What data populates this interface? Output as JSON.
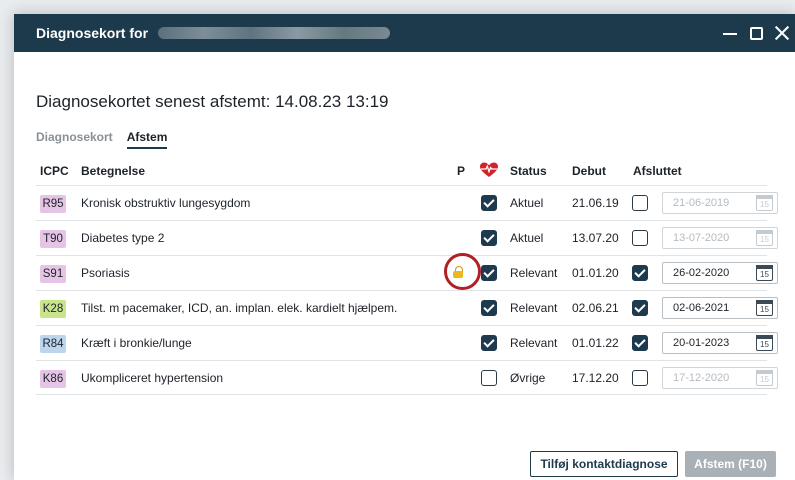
{
  "window": {
    "title": "Diagnosekort for",
    "minimize": "minimize-icon",
    "maximize": "maximize-icon",
    "close": "close-icon"
  },
  "heading": "Diagnosekortet senest afstemt: 14.08.23 13:19",
  "tabs": [
    {
      "label": "Diagnosekort",
      "active": false
    },
    {
      "label": "Afstem",
      "active": true
    }
  ],
  "columns": {
    "icpc": "ICPC",
    "betegnelse": "Betegnelse",
    "p": "P",
    "heart_icon": "heart-pulse-icon",
    "status": "Status",
    "debut": "Debut",
    "afsluttet": "Afsluttet"
  },
  "rows": [
    {
      "code": "R95",
      "code_color": "#e6c4e6",
      "desc": "Kronisk obstruktiv lungesygdom",
      "lock": false,
      "check": true,
      "status": "Aktuel",
      "debut": "21.06.19",
      "afsluttet": false,
      "date": "21-06-2019",
      "date_enabled": false
    },
    {
      "code": "T90",
      "code_color": "#e6c4e6",
      "desc": "Diabetes type 2",
      "lock": false,
      "check": true,
      "status": "Aktuel",
      "debut": "13.07.20",
      "afsluttet": false,
      "date": "13-07-2020",
      "date_enabled": false
    },
    {
      "code": "S91",
      "code_color": "#e6c4e6",
      "desc": "Psoriasis",
      "lock": true,
      "check": true,
      "status": "Relevant",
      "debut": "01.01.20",
      "afsluttet": true,
      "date": "26-02-2020",
      "date_enabled": true
    },
    {
      "code": "K28",
      "code_color": "#c9e58c",
      "desc": "Tilst. m pacemaker, ICD, an. implan. elek. kardielt hjælpem.",
      "lock": false,
      "check": true,
      "status": "Relevant",
      "debut": "02.06.21",
      "afsluttet": true,
      "date": "02-06-2021",
      "date_enabled": true
    },
    {
      "code": "R84",
      "code_color": "#bcd6ee",
      "desc": "Kræft i bronkie/lunge",
      "lock": false,
      "check": true,
      "status": "Relevant",
      "debut": "01.01.22",
      "afsluttet": true,
      "date": "20-01-2023",
      "date_enabled": true
    },
    {
      "code": "K86",
      "code_color": "#e6c4e6",
      "desc": "Ukompliceret hypertension",
      "lock": false,
      "check": false,
      "status": "Øvrige",
      "debut": "17.12.20",
      "afsluttet": false,
      "date": "17-12-2020",
      "date_enabled": false
    }
  ],
  "calendar_day": "15",
  "buttons": {
    "add": "Tilføj kontaktdiagnose",
    "afstem": "Afstem (F10)"
  },
  "colors": {
    "titlebar": "#1c3a4c",
    "checkbox": "#1e3a4e",
    "heart": "#d2232a",
    "highlight": "#b21f24"
  }
}
